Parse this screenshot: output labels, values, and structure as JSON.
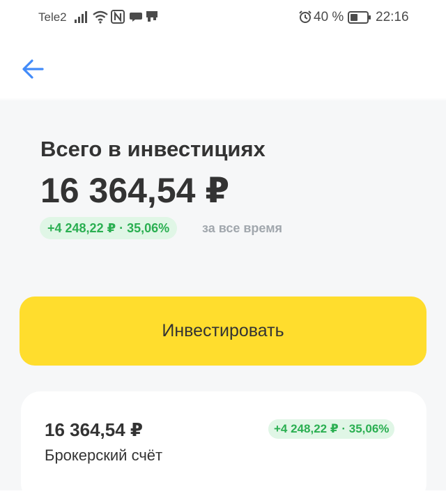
{
  "status_bar": {
    "carrier": "Tele2",
    "battery_percent": "40 %",
    "time": "22:16",
    "icons": [
      "signal-icon",
      "wifi-icon",
      "nfc-icon",
      "chat-icon",
      "notification-icon",
      "alarm-icon",
      "battery-icon"
    ]
  },
  "header": {
    "back_icon": "arrow-left-icon"
  },
  "summary": {
    "title": "Всего в инвестициях",
    "total": "16 364,54 ₽",
    "gain": "+4 248,22 ₽ · 35,06%",
    "period": "за все время"
  },
  "actions": {
    "invest_label": "Инвестировать"
  },
  "account": {
    "amount": "16 364,54 ₽",
    "name": "Брокерский счёт",
    "gain": "+4 248,22 ₽ · 35,06%"
  },
  "colors": {
    "accent_yellow": "#ffdd2d",
    "gain_green": "#2aaf51",
    "gain_bg": "#e0f6e6",
    "back_arrow_blue": "#428bf9",
    "text_primary": "#333333",
    "text_secondary": "#a1a7ad"
  }
}
